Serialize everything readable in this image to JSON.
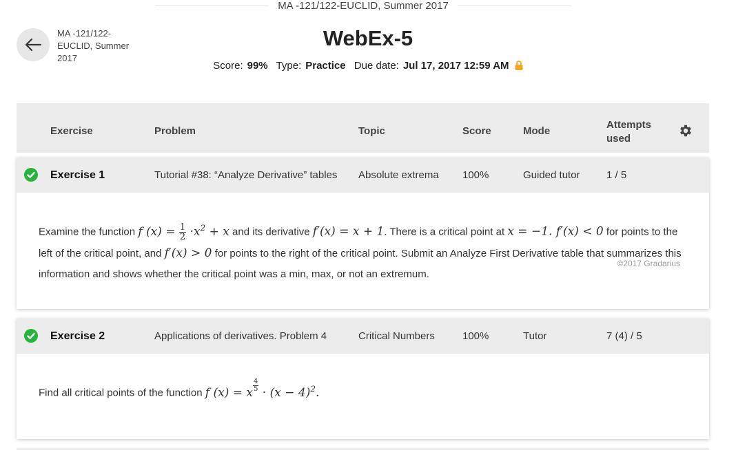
{
  "course_header": "MA -121/122-EUCLID, Summer 2017",
  "breadcrumb": "MA -121/122-EUCLID, Summer 2017",
  "title": "WebEx-5",
  "meta": {
    "score_label": "Score:",
    "score_value": "99%",
    "type_label": "Type:",
    "type_value": "Practice",
    "due_label": "Due date:",
    "due_value": "Jul 17, 2017 12:59 AM"
  },
  "table_headers": {
    "exercise": "Exercise",
    "problem": "Problem",
    "topic": "Topic",
    "score": "Score",
    "mode": "Mode",
    "attempts": "Attempts used"
  },
  "exercises": [
    {
      "name": "Exercise 1",
      "problem": "Tutorial #38: “Analyze Derivative” tables",
      "topic": "Absolute extrema",
      "score": "100%",
      "mode": "Guided tutor",
      "attempts": "1 / 5",
      "text_1": "Examine the function",
      "text_2": "and its derivative",
      "text_3": ". There is a critical point at",
      "text_4": "for points to the left of the critical point, and",
      "text_5": "for points to the right of the critical point. Submit an Analyze First Derivative table that summarizes this information and shows whether the critical point was a min, max, or not an extremum.",
      "copyright": "©2017 Gradarius"
    },
    {
      "name": "Exercise 2",
      "problem": "Applications of derivatives. Problem 4",
      "topic": "Critical Numbers",
      "score": "100%",
      "mode": "Tutor",
      "attempts": "7 (4) / 5",
      "text_1": "Find all critical points of the function"
    }
  ],
  "colors": {
    "check": "#27b43e",
    "lock": "#f5a623",
    "header_bg": "#ebebeb"
  },
  "icons": [
    "back-arrow-icon",
    "lock-icon",
    "gear-icon",
    "check-circle-icon"
  ]
}
